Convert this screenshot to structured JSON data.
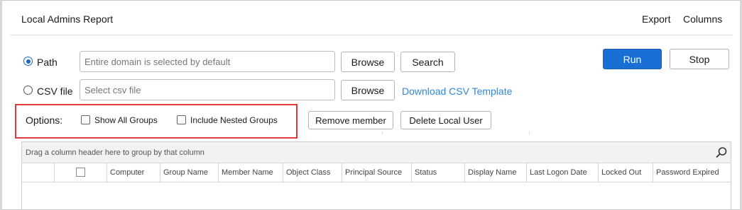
{
  "header": {
    "title": "Local Admins Report",
    "export_label": "Export",
    "columns_label": "Columns"
  },
  "path_row": {
    "radio_label": "Path",
    "selected": true,
    "input_placeholder": "Entire domain is selected by default",
    "browse_label": "Browse",
    "search_label": "Search"
  },
  "csv_row": {
    "radio_label": "CSV file",
    "selected": false,
    "input_placeholder": "Select csv file",
    "browse_label": "Browse",
    "download_link": "Download CSV Template"
  },
  "actions": {
    "run_label": "Run",
    "stop_label": "Stop"
  },
  "options": {
    "label": "Options:",
    "show_all_groups": "Show All Groups",
    "include_nested_groups": "Include Nested Groups",
    "remove_member": "Remove member",
    "delete_local_user": "Delete Local User"
  },
  "grid": {
    "group_hint": "Drag a column header here to group by that column",
    "columns": [
      "Computer",
      "Group Name",
      "Member Name",
      "Object Class",
      "Principal Source",
      "Status",
      "Display Name",
      "Last Logon Date",
      "Locked Out",
      "Password Expired"
    ]
  },
  "colors": {
    "accent": "#1a6fd4",
    "link": "#2f86d8",
    "highlight_border": "#e03b3b"
  }
}
